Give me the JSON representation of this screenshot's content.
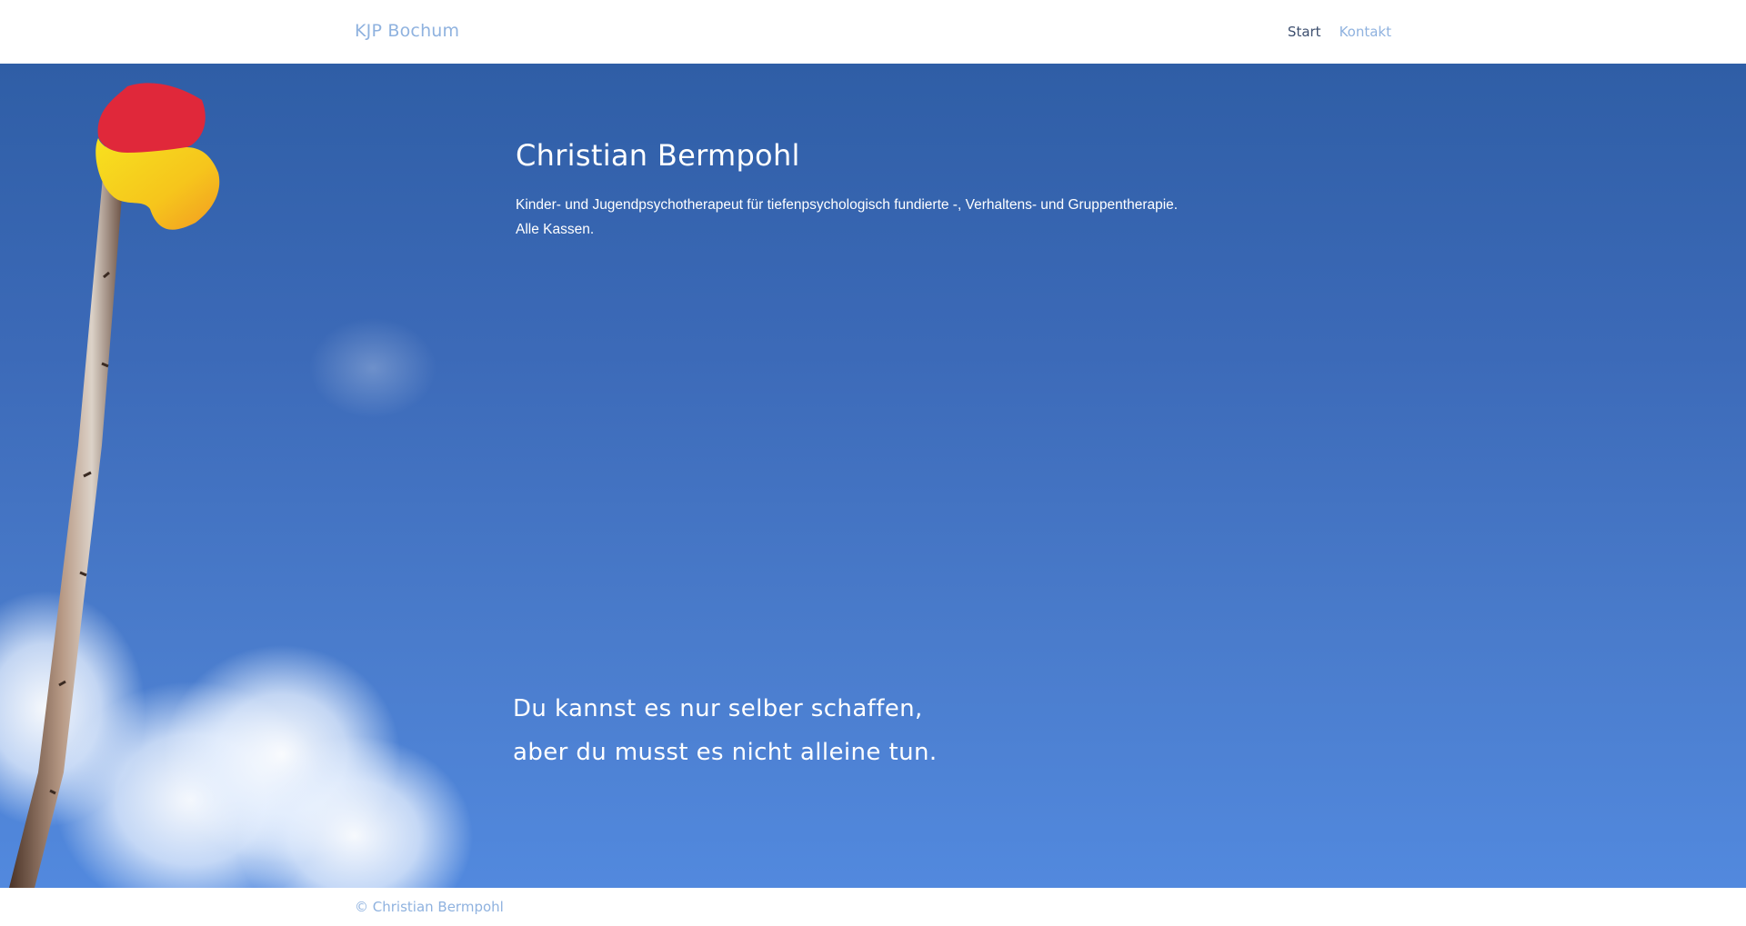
{
  "navbar": {
    "brand": "KJP Bochum",
    "links": [
      {
        "label": "Start",
        "active": true
      },
      {
        "label": "Kontakt",
        "active": false
      }
    ]
  },
  "hero": {
    "title": "Christian Bermpohl",
    "subtitle_lines": [
      "Kinder- und Jugendpsychotherapeut für tiefenpsychologisch fundierte -, Verhaltens- und Gruppentherapie.",
      "Alle Kassen."
    ],
    "quote_lines": [
      "Du kannst es nur selber schaffen,",
      "aber du musst es nicht alleine tun."
    ]
  },
  "footer": {
    "copyright": "© Christian Bermpohl"
  },
  "colors": {
    "link": "#8fb2df",
    "active_link": "#3d4f6f",
    "sky_top": "#2f5ea6",
    "sky_bottom": "#5289de",
    "flag_red": "#e0283a",
    "flag_yellow": "#f7d21a",
    "flag_orange": "#f5a623"
  }
}
